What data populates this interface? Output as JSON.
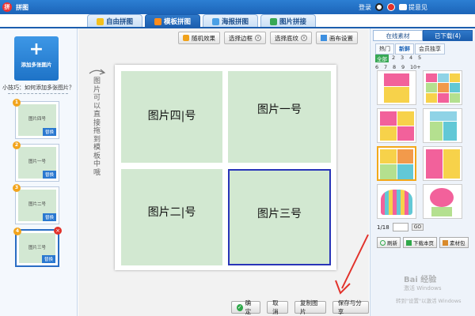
{
  "app": {
    "icon_text": "拼",
    "title": "拼图",
    "login": "登录",
    "feedback": "提意见"
  },
  "tabs": [
    {
      "label": "自由拼图"
    },
    {
      "label": "模板拼图"
    },
    {
      "label": "海报拼图"
    },
    {
      "label": "图片拼接"
    }
  ],
  "left": {
    "add_label": "添加多张图片",
    "tip": "小技巧：如何添加多张图片？",
    "replace": "替换",
    "thumbs": [
      {
        "num": "1",
        "text": "图片四号"
      },
      {
        "num": "2",
        "text": "图片一号"
      },
      {
        "num": "3",
        "text": "图片二号"
      },
      {
        "num": "4",
        "text": "图片三号"
      }
    ]
  },
  "toolbar": {
    "random": "随机效果",
    "border": "选择边框",
    "texture": "选择底纹",
    "canvas": "画布设置"
  },
  "hint": "图片可以直接拖到模板中哦",
  "canvas": {
    "cells": [
      "图片四|号",
      "图片一号",
      "图片二|号",
      "图片三号"
    ]
  },
  "bottom": {
    "ok": "确定",
    "cancel": "取消",
    "copy": "复制图片",
    "save": "保存与分享"
  },
  "right": {
    "tab_online": "在线素材",
    "tab_downloaded": "已下载(4)",
    "sub_hot": "热门",
    "sub_new": "新鲜",
    "sub_vip": "会员独享",
    "nums": [
      "全部",
      "2",
      "3",
      "4",
      "5",
      "6",
      "7",
      "8",
      "9",
      "10+"
    ],
    "page": "1/18",
    "go": "GO",
    "refresh": "刷新",
    "download_page": "下载本页",
    "material_pack": "素材包"
  },
  "watermark": {
    "line1": "Bai 经验",
    "line2": "激活 Windows",
    "line3": "转到\"设置\"以激活 Windows"
  },
  "colors": {
    "accent": "#1c64b8",
    "cell": "#d2e8d1",
    "selected": "#2834b8"
  }
}
